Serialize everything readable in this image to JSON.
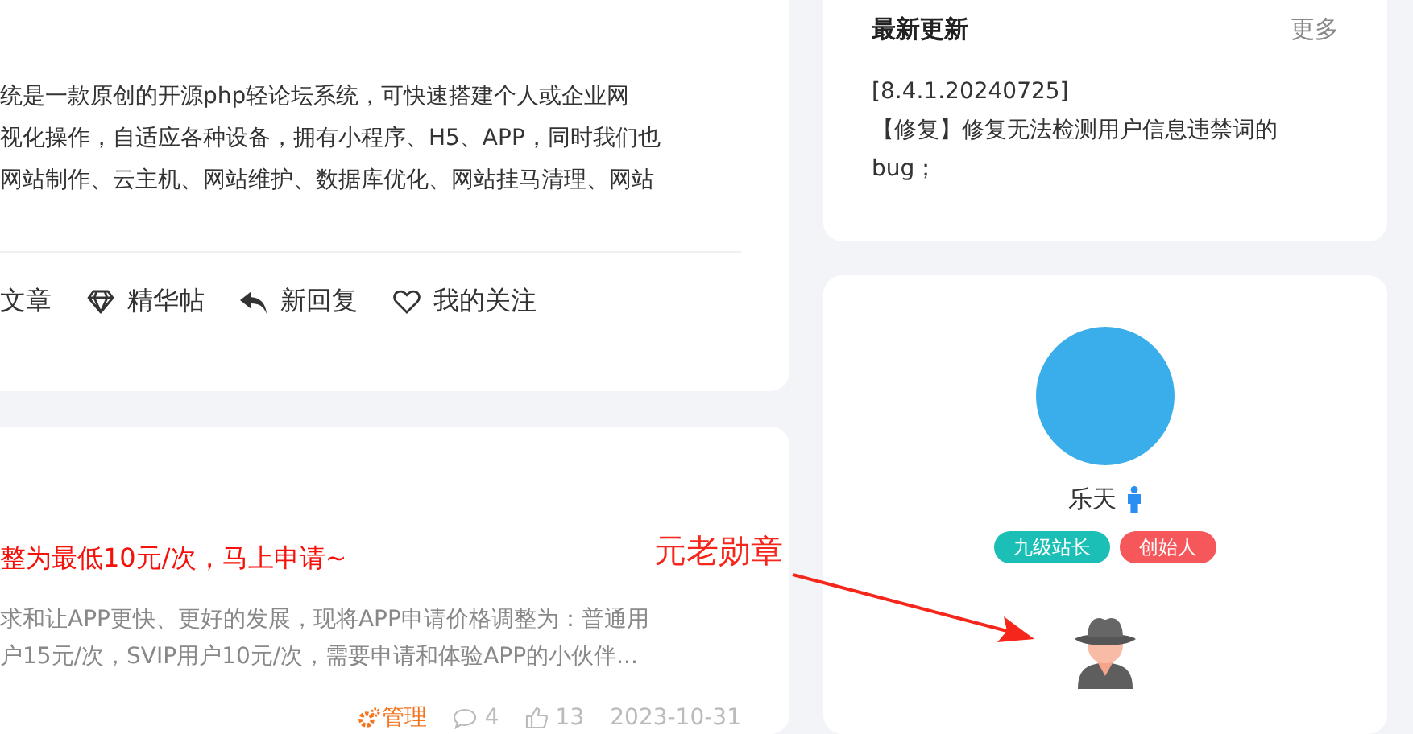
{
  "intro_card": {
    "description_lines": [
      "统是一款原创的开源php轻论坛系统，可快速搭建个人或企业网",
      "视化操作，自适应各种设备，拥有小程序、H5、APP，同时我们也",
      "网站制作、云主机、网站维护、数据库优化、网站挂马清理、网站"
    ],
    "nav_links": [
      {
        "label": "文章"
      },
      {
        "label": "精华帖"
      },
      {
        "label": "新回复"
      },
      {
        "label": "我的关注"
      }
    ]
  },
  "post": {
    "title": "整为最低10元/次，马上申请~",
    "summary_lines": [
      "求和让APP更快、更好的发展，现将APP申请价格调整为：普通用",
      "户15元/次，SVIP用户10元/次，需要申请和体验APP的小伙伴..."
    ],
    "tag": "管理",
    "comments": "4",
    "likes": "13",
    "date": "2023-10-31"
  },
  "annotation": {
    "text": "元老勋章"
  },
  "updates": {
    "title": "最新更新",
    "more": "更多",
    "lines": [
      "[8.4.1.20240725]",
      "【修复】修复无法检测用户信息违禁词的",
      "bug；"
    ]
  },
  "profile": {
    "name": "乐天",
    "male": true,
    "badges": [
      {
        "label": "九级站长",
        "color": "#1bbfb5"
      },
      {
        "label": "创始人",
        "color": "#f5575b"
      }
    ]
  }
}
